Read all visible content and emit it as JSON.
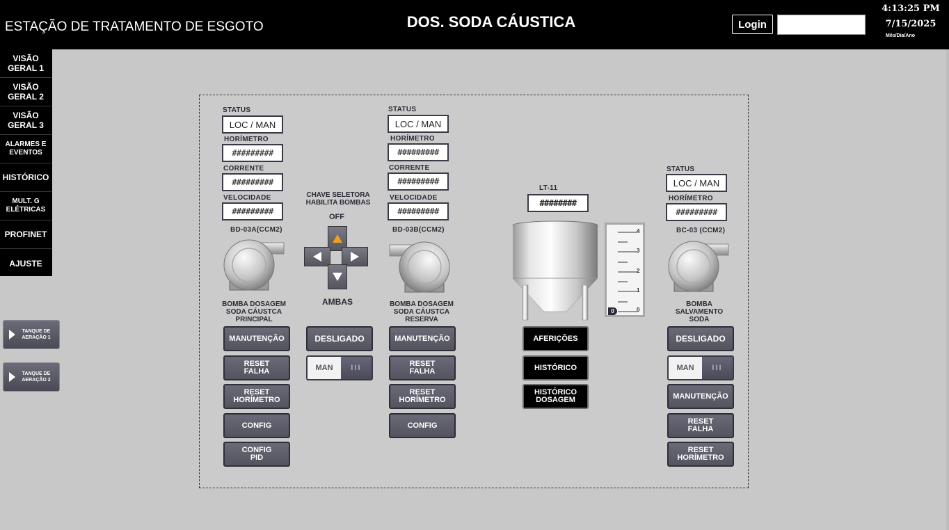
{
  "header": {
    "plant_title": "ESTAÇÃO DE TRATAMENTO DE ESGOTO",
    "screen_title": "DOS.  SODA CÁUSTICA",
    "login_label": "Login",
    "login_value": "",
    "time": "4:13:25 PM",
    "date": "7/15/2025",
    "date_format": "Mês/Dia/Ano"
  },
  "nav": {
    "items": [
      {
        "label": "VISÃO GERAL 1"
      },
      {
        "label": "VISÃO GERAL 2"
      },
      {
        "label": "VISÃO GERAL 3"
      },
      {
        "label": "ALARMES E EVENTOS"
      },
      {
        "label": "HISTÓRICO"
      },
      {
        "label": "MULT. G ELÉTRICAS"
      },
      {
        "label": "PROFINET"
      },
      {
        "label": "AJUSTE"
      }
    ],
    "side_buttons": [
      {
        "label": "TANQUE DE AERAÇÃO 1"
      },
      {
        "label": "TANQUE DE AERAÇÃO 2"
      }
    ]
  },
  "pump_a": {
    "status_label": "STATUS",
    "status_value": "LOC / MAN",
    "horimetro_label": "HORÍMETRO",
    "horimetro_value": "#########",
    "corrente_label": "CORRENTE",
    "corrente_value": "#########",
    "velocidade_label": "VELOCIDADE",
    "velocidade_value": "#########",
    "tag": "BD-03A(CCM2)",
    "caption": "BOMBA DOSAGEM SODA CÁUSTCA PRINCIPAL",
    "buttons": [
      "MANUTENÇÃO",
      "RESET FALHA",
      "RESET HORÍMETRO",
      "CONFIG",
      "CONFIG PID"
    ]
  },
  "selector": {
    "title": "CHAVE SELETORA HABILITA BOMBAS",
    "top_label": "OFF",
    "bottom_label": "AMBAS",
    "state_button": "DESLIGADO",
    "mode_label": "MAN",
    "mode_grip": "III"
  },
  "pump_b": {
    "status_label": "STATUS",
    "status_value": "LOC / MAN",
    "horimetro_label": "HORÍMETRO",
    "horimetro_value": "#########",
    "corrente_label": "CORRENTE",
    "corrente_value": "#########",
    "velocidade_label": "VELOCIDADE",
    "velocidade_value": "#########",
    "tag": "BD-03B(CCM2)",
    "caption": "BOMBA DOSAGEM SODA CÁUSTCA RESERVA",
    "buttons": [
      "MANUTENÇÃO",
      "RESET FALHA",
      "RESET HORÍMETRO",
      "CONFIG"
    ]
  },
  "tank": {
    "tag": "LT-11",
    "value": "########",
    "scale_ticks": [
      "4",
      "3",
      "2",
      "1",
      "0"
    ],
    "level_marker": "0",
    "level": 0,
    "buttons": [
      "AFERIÇÕES",
      "HISTÓRICO",
      "HISTÓRICO DOSAGEM"
    ]
  },
  "pump_c": {
    "status_label": "STATUS",
    "status_value": "LOC / MAN",
    "horimetro_label": "HORÍMETRO",
    "horimetro_value": "#########",
    "tag": "BC-03 (CCM2)",
    "caption": "BOMBA SALVAMENTO SODA",
    "state_button": "DESLIGADO",
    "mode_label": "MAN",
    "mode_grip": "III",
    "buttons": [
      "MANUTENÇÃO",
      "RESET FALHA",
      "RESET HORÍMETRO"
    ]
  }
}
